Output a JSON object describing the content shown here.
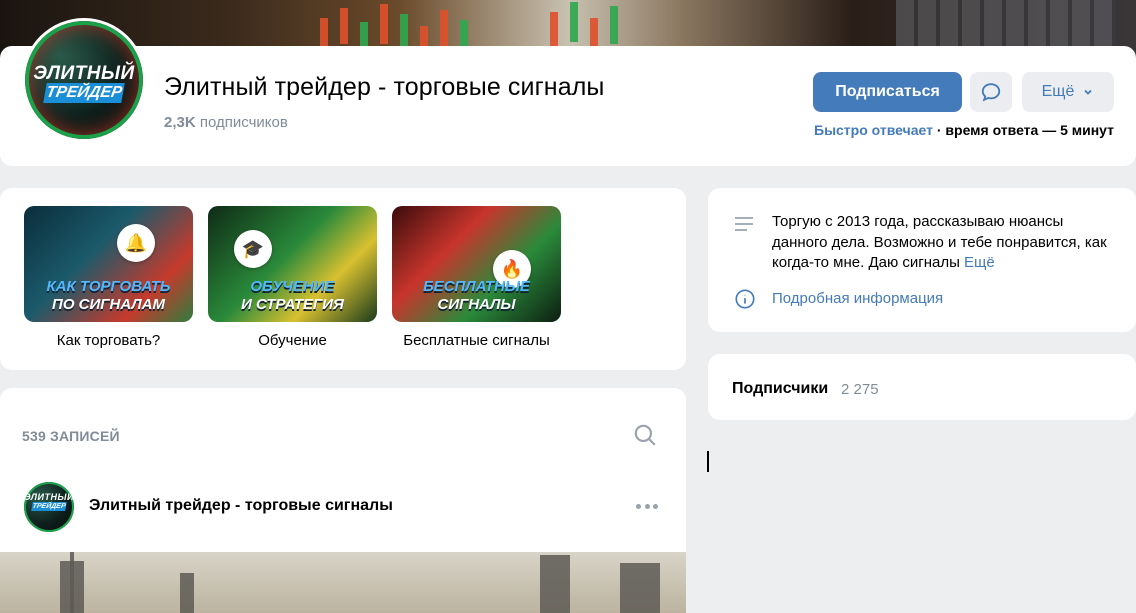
{
  "group": {
    "title": "Элитный трейдер - торговые сигналы",
    "subscribers_count": "2,3K",
    "subscribers_label": "подписчиков",
    "logo_line1": "ЭЛИТНЫЙ",
    "logo_line2": "ТРЕЙДЕР"
  },
  "actions": {
    "subscribe_label": "Подписаться",
    "more_label": "Ещё"
  },
  "response": {
    "fast": "Быстро отвечает",
    "separator": "·",
    "time": "время ответа — 5 минут"
  },
  "links": [
    {
      "thumb_line1": "КАК ТОРГОВАТЬ",
      "thumb_line2": "ПО СИГНАЛАМ",
      "label": "Как торговать?",
      "badge_icon": "bell-icon"
    },
    {
      "thumb_line1": "ОБУЧЕНИЕ",
      "thumb_line2": "И СТРАТЕГИЯ",
      "label": "Обучение",
      "badge_icon": "graduation-cap-icon"
    },
    {
      "thumb_line1": "БЕСПЛАТНЫЕ",
      "thumb_line2": "СИГНАЛЫ",
      "label": "Бесплатные сигналы",
      "badge_icon": "fire-icon"
    }
  ],
  "wall": {
    "count_label": "539 ЗАПИСЕЙ",
    "post_author": "Элитный трейдер - торговые сигналы"
  },
  "info": {
    "description": "Торгую с 2013 года, рассказываю нюансы данного дела. Возможно и тебе понравится, как когда-то мне. Даю сигналы",
    "more_link": "Ещё",
    "detail_link": "Подробная информация"
  },
  "followers": {
    "label": "Подписчики",
    "count": "2 275"
  },
  "colors": {
    "accent": "#447bba",
    "muted": "#818c99",
    "background": "#edeef0"
  }
}
